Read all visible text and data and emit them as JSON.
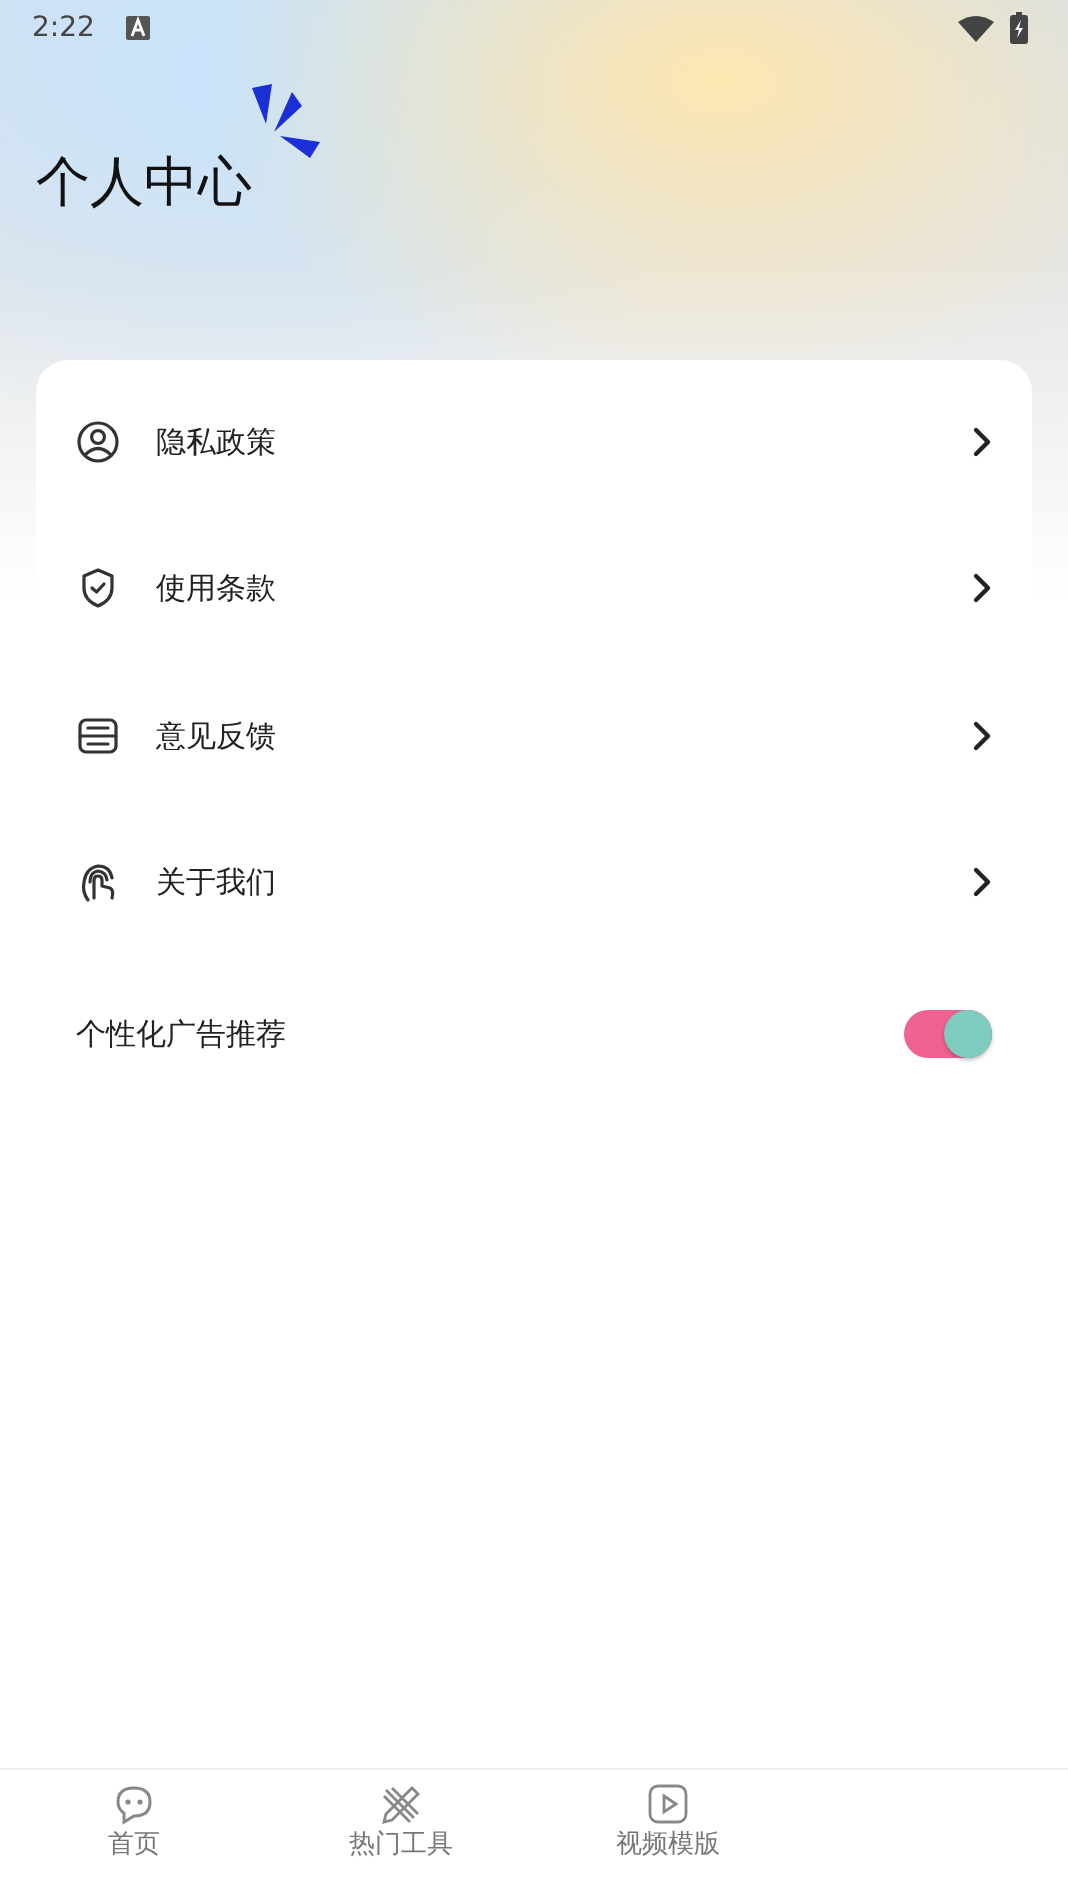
{
  "status_bar": {
    "time": "2:22"
  },
  "title": "个人中心",
  "menu": [
    {
      "kind": "link",
      "label": "隐私政策"
    },
    {
      "kind": "link",
      "label": "使用条款"
    },
    {
      "kind": "link",
      "label": "意见反馈"
    },
    {
      "kind": "link",
      "label": "关于我们"
    },
    {
      "kind": "switch",
      "label": "个性化广告推荐",
      "on": true
    }
  ],
  "tab_bar": [
    {
      "label": "首页"
    },
    {
      "label": "热门工具"
    },
    {
      "label": "视频模版"
    }
  ]
}
